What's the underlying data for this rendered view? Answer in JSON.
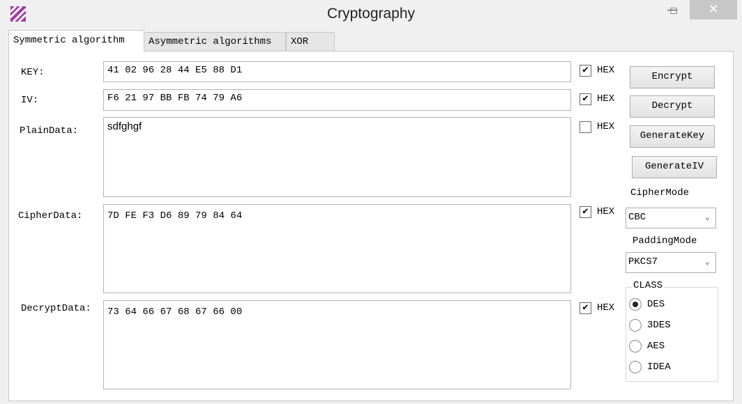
{
  "window": {
    "title": "Cryptography",
    "minimize": "—",
    "maximize": "☐",
    "close": "✕"
  },
  "tabs": [
    {
      "label": "Symmetric algorithm"
    },
    {
      "label": "Asymmetric algorithms"
    },
    {
      "label": "XOR"
    }
  ],
  "fields": {
    "key": {
      "label": "KEY:",
      "value": "41 02 96 28 44 E5 88 D1",
      "hex": true
    },
    "iv": {
      "label": "IV:",
      "value": "F6 21 97 BB FB 74 79 A6",
      "hex": true
    },
    "plain": {
      "label": "PlainData:",
      "value": "sdfghgf",
      "hex": false
    },
    "cipher": {
      "label": "CipherData:",
      "value": "7D FE F3 D6 89 79 84 64",
      "hex": true
    },
    "decrypt": {
      "label": "DecryptData:",
      "value": "73 64 66 67 68 67 66 00",
      "hex": true
    }
  },
  "hex_label": "HEX",
  "check_mark": "✔",
  "buttons": {
    "encrypt": "Encrypt",
    "decrypt": "Decrypt",
    "generate_key": "GenerateKey",
    "generate_iv": "GenerateIV"
  },
  "cipher_mode": {
    "label": "CipherMode",
    "value": "CBC"
  },
  "padding_mode": {
    "label": "PaddingMode",
    "value": "PKCS7"
  },
  "chevron": "⌄",
  "class_group": {
    "label": "CLASS",
    "options": [
      {
        "label": "DES",
        "selected": true
      },
      {
        "label": "3DES",
        "selected": false
      },
      {
        "label": "AES",
        "selected": false
      },
      {
        "label": "IDEA",
        "selected": false
      }
    ]
  },
  "colors": {
    "app_icon": "#a23aa8",
    "close_bg": "#c7c7c7"
  }
}
